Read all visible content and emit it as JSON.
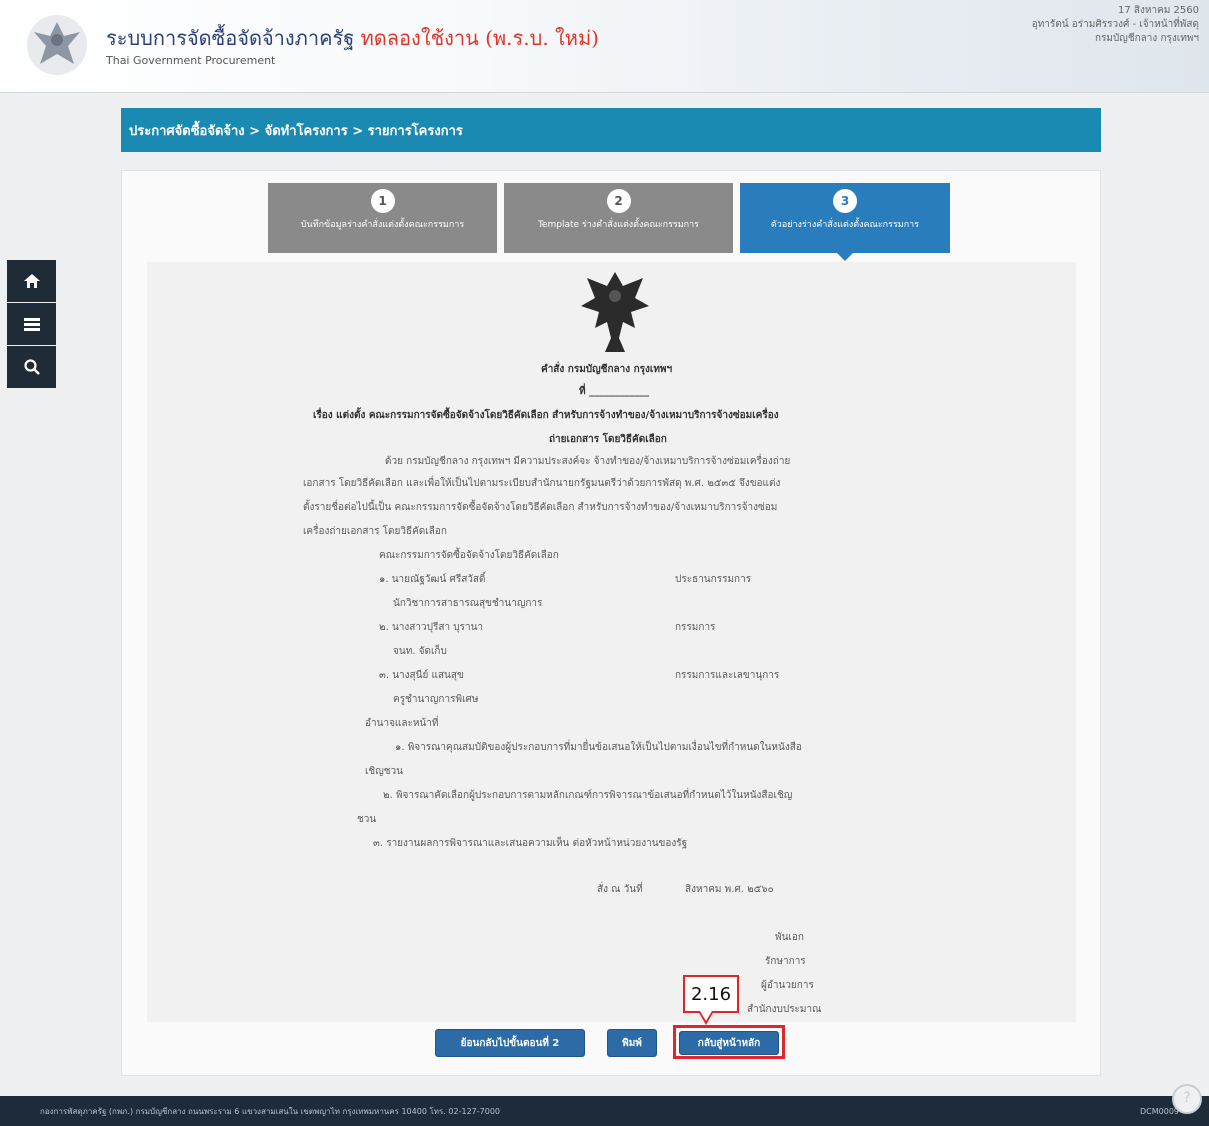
{
  "header": {
    "title_main": "ระบบการจัดซื้อจัดจ้างภาครัฐ ",
    "title_trial": "ทดลองใช้งาน (พ.ร.บ. ใหม่)",
    "subtitle": "Thai Government Procurement",
    "date": "17 สิงหาคม 2560",
    "user": "อุทารัตน์ อร่ามศิรรวงศ์ - เจ้าหน้าที่พัสดุ",
    "org": "กรมบัญชีกลาง กรุงเทพฯ"
  },
  "breadcrumb": "ประกาศจัดซื้อจัดจ้าง > จัดทำโครงการ > รายการโครงการ",
  "steps": [
    {
      "num": "1",
      "label": "บันทึกข้อมูลร่างคำสั่งแต่งตั้งคณะกรรมการ"
    },
    {
      "num": "2",
      "label": "Template ร่างคำสั่งแต่งตั้งคณะกรรมการ"
    },
    {
      "num": "3",
      "label": "ตัวอย่างร่างคำสั่งแต่งตั้งคณะกรรมการ"
    }
  ],
  "document": {
    "order_title": "คำสั่ง กรมบัญชีกลาง กรุงเทพฯ",
    "number": "ที่ ____________",
    "subject_line1": "เรื่อง แต่งตั้ง คณะกรรมการจัดซื้อจัดจ้างโดยวิธีคัดเลือก สำหรับการจ้างทำของ/จ้างเหมาบริการจ้างซ่อมเครื่อง",
    "subject_line2": "ถ่ายเอกสาร โดยวิธีคัดเลือก",
    "body1": "ด้วย กรมบัญชีกลาง กรุงเทพฯ มีความประสงค์จะ จ้างทำของ/จ้างเหมาบริการจ้างซ่อมเครื่องถ่าย",
    "body2": "เอกสาร โดยวิธีคัดเลือก และเพื่อให้เป็นไปตามระเบียบสำนักนายกรัฐมนตรีว่าด้วยการพัสดุ พ.ศ. ๒๕๓๕ จึงขอแต่ง",
    "body3": "ตั้งรายชื่อต่อไปนี้เป็น คณะกรรมการจัดซื้อจัดจ้างโดยวิธีคัดเลือก สำหรับการจ้างทำของ/จ้างเหมาบริการจ้างซ่อม",
    "body4": "เครื่องถ่ายเอกสาร โดยวิธีคัดเลือก",
    "committee_heading": "คณะกรรมการจัดซื้อจัดจ้างโดยวิธีคัดเลือก",
    "member1_name": "๑. นายณัฐวัฒน์ ศรีสวัสดิ์",
    "member1_role": "ประธานกรรมการ",
    "member1_pos": "นักวิชาการสาธารณสุขชำนาญการ",
    "member2_name": "๒. นางสาวปุรีสา บุรานา",
    "member2_role": "กรรมการ",
    "member2_pos": "จนท. จัดเก็บ",
    "member3_name": "๓. นางสุนีย์ แสนสุข",
    "member3_role": "กรรมการและเลขานุการ",
    "member3_pos": "ครูชำนาญการพิเศษ",
    "duty_heading": "อำนาจและหน้าที่",
    "duty1a": "๑. พิจารณาคุณสมบัติของผู้ประกอบการที่มายื่นข้อเสนอให้เป็นไปตามเงื่อนไขที่กำหนดในหนังสือ",
    "duty1b": "เชิญชวน",
    "duty2a": "๒. พิจารณาคัดเลือกผู้ประกอบการตามหลักเกณฑ์การพิจารณาข้อเสนอที่กำหนดไว้ในหนังสือเชิญ",
    "duty2b": "ชวน",
    "duty3": "๓. รายงานผลการพิจารณาและเสนอความเห็น ต่อหัวหน้าหน่วยงานของรัฐ",
    "signed_date_label": "สั่ง ณ วันที่",
    "signed_date_value": "สิงหาคม พ.ศ. ๒๕๖๐",
    "sign1": "พันเอก",
    "sign2": "รักษาการ",
    "sign3": "ผู้อำนวยการ",
    "sign4": "สำนักงบประมาณ"
  },
  "buttons": {
    "back": "ย้อนกลับไปขั้นตอนที่ 2",
    "print": "พิมพ์",
    "home": "กลับสู่หน้าหลัก"
  },
  "annotation": "2.16",
  "footer": {
    "text": "กองการพัสดุภาครัฐ (กพภ.) กรมบัญชีกลาง ถนนพระราม 6 แขวงสามเสนใน เขตพญาไท กรุงเทพมหานคร 10400 โทร. 02-127-7000",
    "code": "DCM0009"
  }
}
